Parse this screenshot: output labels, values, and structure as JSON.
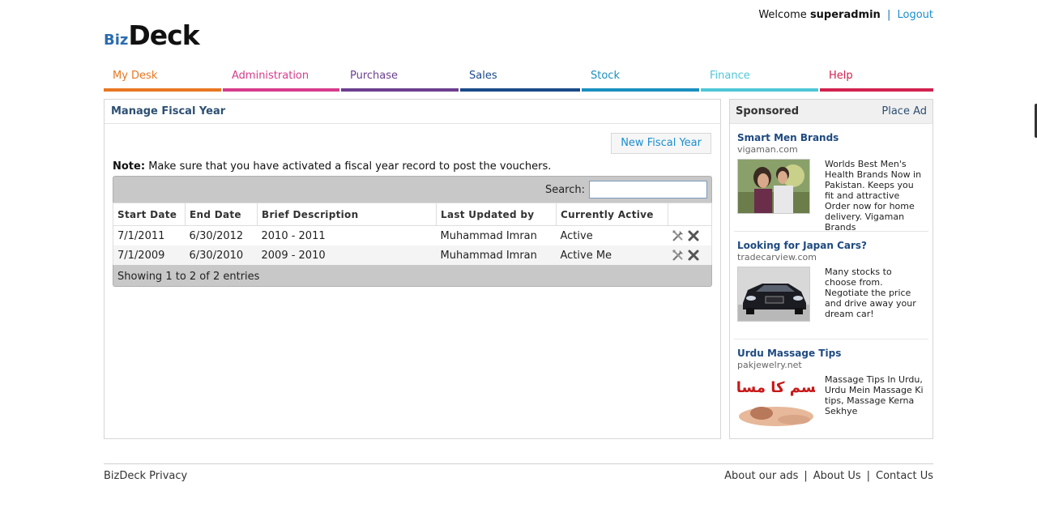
{
  "header": {
    "welcome_prefix": "Welcome",
    "username": "superadmin",
    "separator": "|",
    "logout_label": "Logout"
  },
  "logo": {
    "part1": "Biz",
    "part2": "Deck"
  },
  "nav": {
    "items": [
      {
        "label": "My Desk",
        "color": "#e87722"
      },
      {
        "label": "Administration",
        "color": "#d63c8c"
      },
      {
        "label": "Purchase",
        "color": "#6b3f8f"
      },
      {
        "label": "Sales",
        "color": "#1a4a8a"
      },
      {
        "label": "Stock",
        "color": "#1a8fc0"
      },
      {
        "label": "Finance",
        "color": "#4fc6d8"
      },
      {
        "label": "Help",
        "color": "#d2224e"
      }
    ]
  },
  "main": {
    "title": "Manage Fiscal Year",
    "new_button_label": "New Fiscal Year",
    "note_label": "Note:",
    "note_text": "Make sure that you have activated a fiscal year record to post the vouchers.",
    "search_label": "Search:",
    "search_value": "",
    "columns": [
      "Start Date",
      "End Date",
      "Brief Description",
      "Last Updated by",
      "Currently Active",
      ""
    ],
    "rows": [
      {
        "start": "7/1/2011",
        "end": "6/30/2012",
        "desc": "2010 - 2011",
        "updated_by": "Muhammad Imran",
        "status": "Active"
      },
      {
        "start": "7/1/2009",
        "end": "6/30/2010",
        "desc": "2009 - 2010",
        "updated_by": "Muhammad Imran",
        "status": "Active Me"
      }
    ],
    "row_icons": [
      "edit-tools-icon",
      "delete-x-icon"
    ],
    "footer_text": "Showing 1 to 2 of 2 entries"
  },
  "sidebar": {
    "title": "Sponsored",
    "place_ad_label": "Place Ad",
    "ads": [
      {
        "title": "Smart Men Brands",
        "url": "vigaman.com",
        "text": "Worlds Best Men's Health Brands Now in Pakistan. Keeps you fit and attractive Order now for home delivery. Vigaman Brands",
        "image": "couple-photo"
      },
      {
        "title": "Looking for Japan Cars?",
        "url": "tradecarview.com",
        "text": "Many stocks to choose from. Negotiate the price and drive away your dream car!",
        "image": "black-car-photo"
      },
      {
        "title": "Urdu Massage Tips",
        "url": "pakjewelry.net",
        "text": "Massage Tips In Urdu, Urdu Mein Massage Ki tips, Massage Kerna Sekhye",
        "image": "urdu-massage-banner",
        "image_text": "جسم کا مساج"
      }
    ]
  },
  "footer": {
    "left": "BizDeck Privacy",
    "links": [
      "About our ads",
      "About Us",
      "Contact Us"
    ],
    "separator": "|"
  }
}
